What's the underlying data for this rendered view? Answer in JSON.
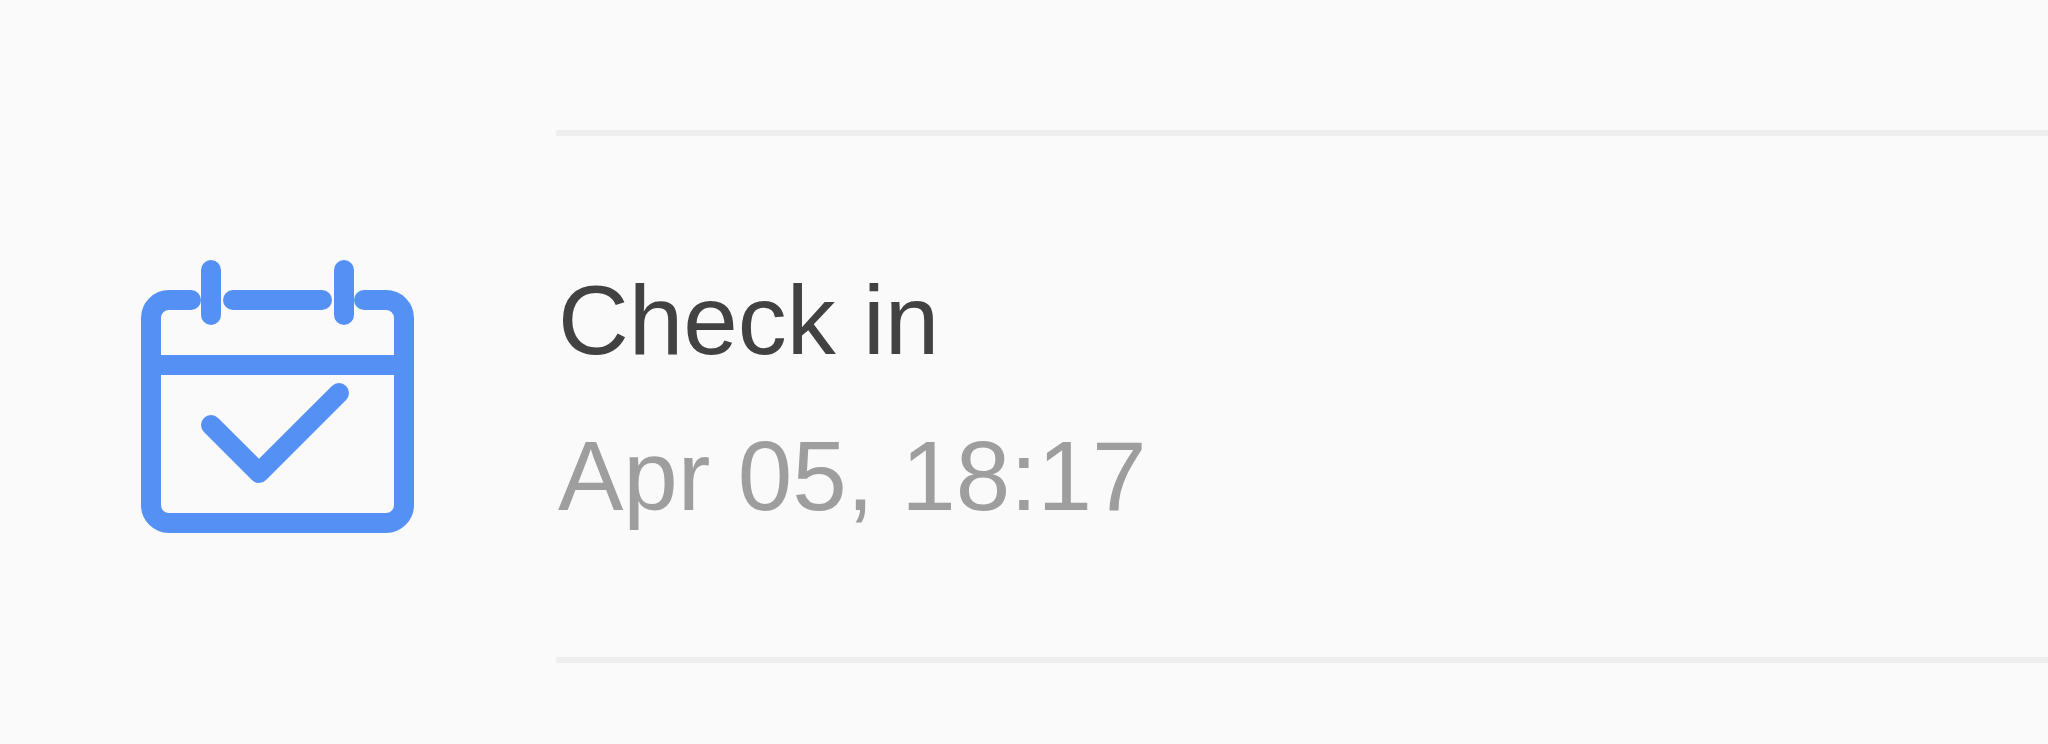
{
  "events": [
    {
      "kind": "check_in",
      "title": "Check in",
      "time": "Apr 05, 18:17"
    }
  ]
}
